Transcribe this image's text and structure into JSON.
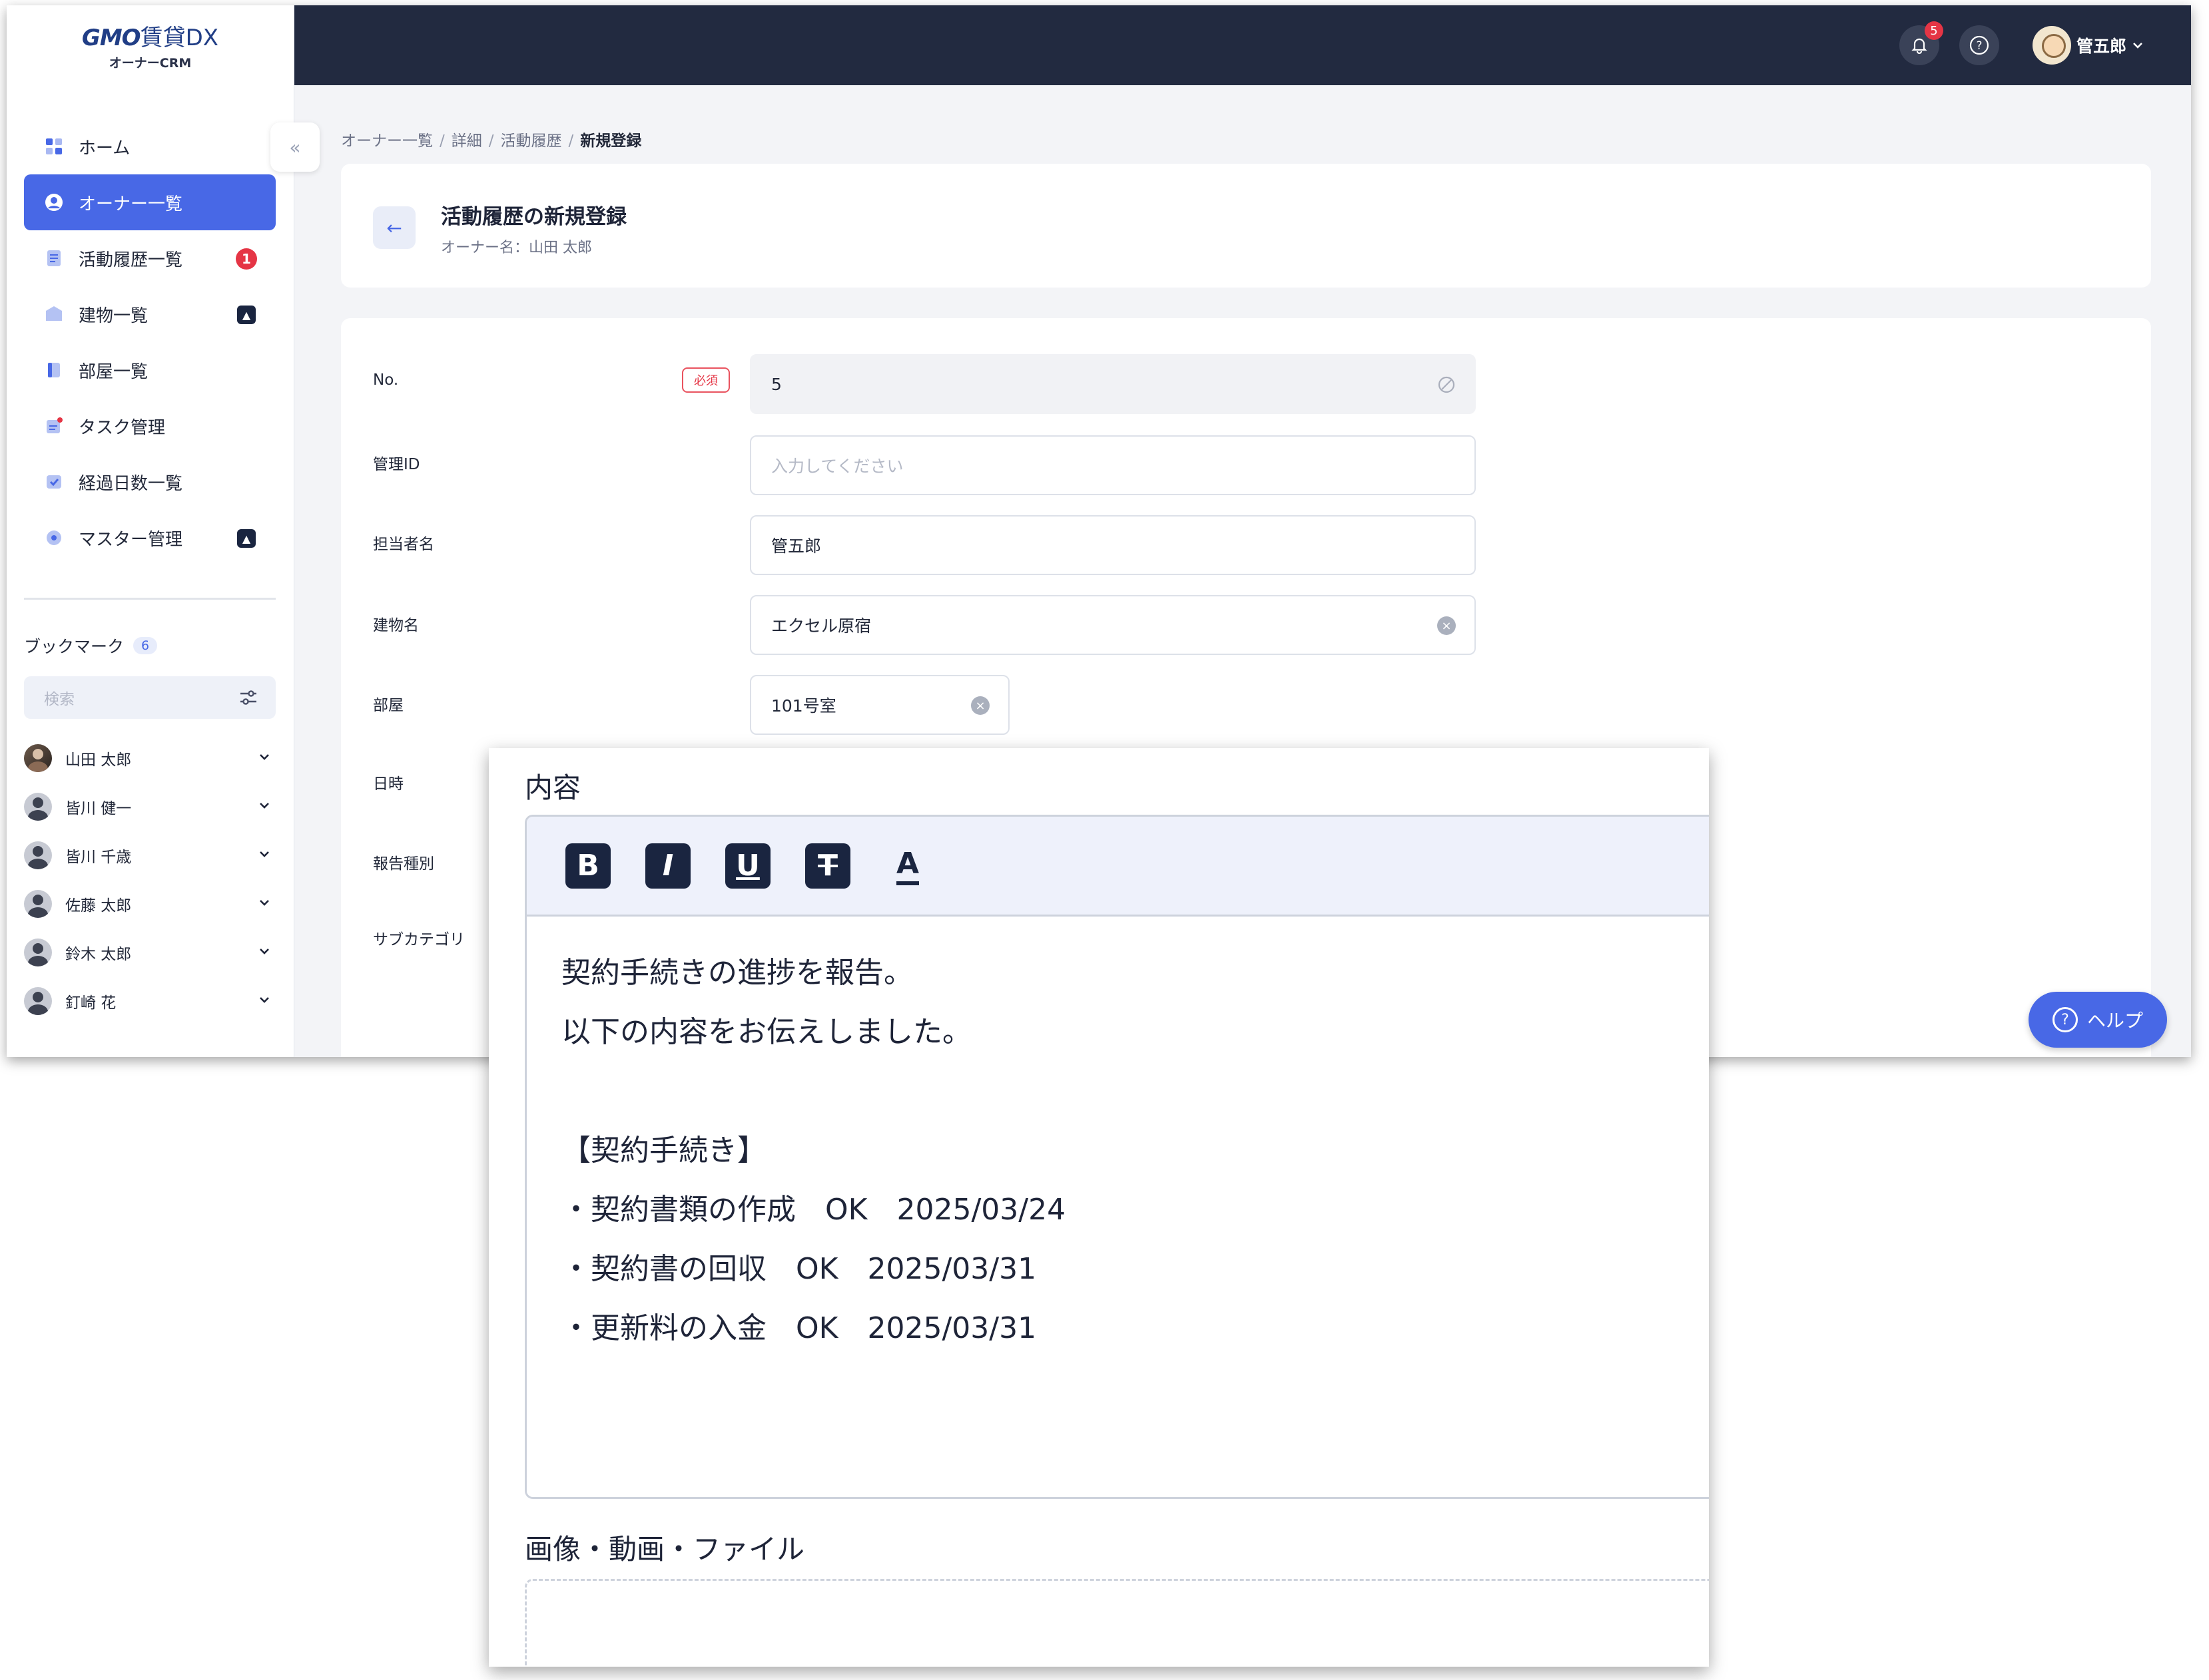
{
  "app": {
    "logo_main_prefix": "GMO",
    "logo_main_suffix": "賃貸DX",
    "logo_sub": "オーナーCRM"
  },
  "sidebar": {
    "items": [
      {
        "label": "ホーム",
        "icon": "dashboard-icon"
      },
      {
        "label": "オーナー一覧",
        "icon": "user-circle-icon",
        "active": true
      },
      {
        "label": "活動履歴一覧",
        "icon": "document-icon",
        "badge": "1"
      },
      {
        "label": "建物一覧",
        "icon": "building-icon",
        "expand": true
      },
      {
        "label": "部屋一覧",
        "icon": "room-icon"
      },
      {
        "label": "タスク管理",
        "icon": "task-icon"
      },
      {
        "label": "経過日数一覧",
        "icon": "calendar-check-icon"
      },
      {
        "label": "マスター管理",
        "icon": "settings-icon",
        "expand": true
      }
    ],
    "bookmarks": {
      "title": "ブックマーク",
      "count": "6",
      "search_placeholder": "検索",
      "items": [
        "山田 太郎",
        "皆川 健一",
        "皆川 千歳",
        "佐藤 太郎",
        "鈴木 太郎",
        "釘崎 花"
      ]
    }
  },
  "topbar": {
    "notification_count": "5",
    "user_name": "管五郎"
  },
  "breadcrumb": [
    "オーナー一覧",
    "詳細",
    "活動履歴",
    "新規登録"
  ],
  "header": {
    "title": "活動履歴の新規登録",
    "subtitle": "オーナー名：山田 太郎"
  },
  "form": {
    "required_label": "必須",
    "fields": {
      "no": {
        "label": "No.",
        "value": "5"
      },
      "management_id": {
        "label": "管理ID",
        "placeholder": "入力してください"
      },
      "person": {
        "label": "担当者名",
        "value": "管五郎"
      },
      "building": {
        "label": "建物名",
        "value": "エクセル原宿"
      },
      "room": {
        "label": "部屋",
        "value": "101号室"
      },
      "datetime": {
        "label": "日時"
      },
      "report_type": {
        "label": "報告種別"
      },
      "subcategory": {
        "label": "サブカテゴリ"
      }
    }
  },
  "help_button": "ヘルプ",
  "overlay": {
    "content_label": "内容",
    "toolbar": [
      "bold-icon",
      "italic-icon",
      "underline-icon",
      "strikethrough-icon",
      "text-color-icon"
    ],
    "body_lines": [
      "契約手続きの進捗を報告。",
      "以下の内容をお伝えしました。",
      "",
      "【契約手続き】",
      "・契約書類の作成　OK　2025/03/24",
      "・契約書の回収　OK　2025/03/31",
      "・更新料の入金　OK　2025/03/31"
    ],
    "files_label": "画像・動画・ファイル"
  },
  "colors": {
    "accent": "#4868e6",
    "topbar": "#222a40",
    "badge": "#e53545"
  }
}
